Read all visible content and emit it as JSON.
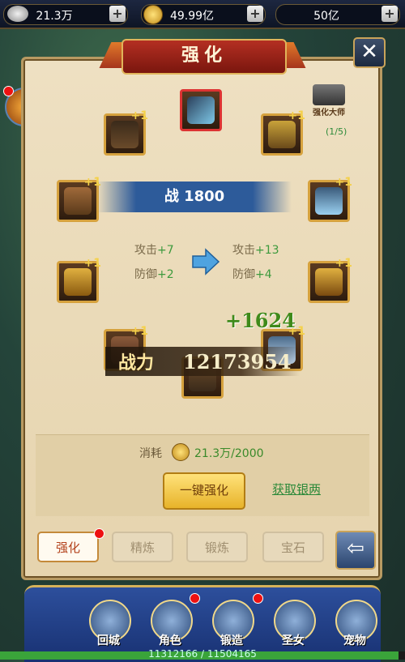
{
  "top_bar": {
    "silver": "21.3万",
    "gold": "49.99亿",
    "gems": "50亿",
    "plus": "+"
  },
  "panel": {
    "title": "强化",
    "close": "✕",
    "master_label": "强化大师",
    "master_count": "(1/5)",
    "combat_label": "战 1800",
    "stat_before": {
      "atk": "攻击",
      "atk_val": "+7",
      "def": "防御",
      "def_val": "+2"
    },
    "stat_after": {
      "atk": "攻击",
      "atk_val": "+13",
      "def": "防御",
      "def_val": "+4"
    },
    "float_gain": "+1624",
    "power_label": "战力",
    "power_value": "12173954",
    "cost_label": "消耗",
    "cost_value": "21.3万/2000",
    "action_button": "一键强化",
    "get_silver_link": "获取银两"
  },
  "slot_plus": "+1",
  "tabs": [
    {
      "label": "强化",
      "active": true
    },
    {
      "label": "精炼",
      "active": false
    },
    {
      "label": "锻炼",
      "active": false
    },
    {
      "label": "宝石",
      "active": false
    }
  ],
  "back": "⇦",
  "bottom_nav": [
    {
      "label": "回城"
    },
    {
      "label": "角色"
    },
    {
      "label": "锻造"
    },
    {
      "label": "圣女"
    },
    {
      "label": "宠物"
    }
  ],
  "exp_text": "11312166 / 11504165",
  "exp_progress": 0.983,
  "colors": {
    "accent_green": "#3a8a2a",
    "panel_border": "#b89a62",
    "title_red": "#b42f22"
  }
}
